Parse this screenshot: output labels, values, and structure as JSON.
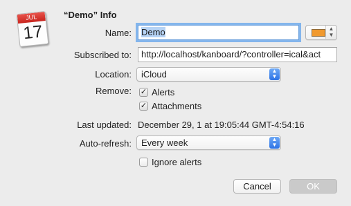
{
  "dialog": {
    "title": "“Demo” Info",
    "calendar_icon": {
      "month": "JUL",
      "day": "17"
    }
  },
  "form": {
    "name_label": "Name:",
    "name_value": "Demo",
    "calendar_color": "#f0992e",
    "subscribed_label": "Subscribed to:",
    "subscribed_value": "http://localhost/kanboard/?controller=ical&act",
    "location_label": "Location:",
    "location_value": "iCloud",
    "remove_label": "Remove:",
    "remove_options": [
      {
        "label": "Alerts",
        "checked": true
      },
      {
        "label": "Attachments",
        "checked": true
      }
    ],
    "last_updated_label": "Last updated:",
    "last_updated_value": "December 29, 1 at 19:05:44 GMT-4:54:16",
    "autorefresh_label": "Auto-refresh:",
    "autorefresh_value": "Every week",
    "ignore_alerts_label": "Ignore alerts",
    "ignore_alerts_checked": false
  },
  "buttons": {
    "cancel": "Cancel",
    "ok": "OK"
  },
  "icons": {
    "check": "✓",
    "chevron_up": "▲",
    "chevron_down": "▼"
  }
}
